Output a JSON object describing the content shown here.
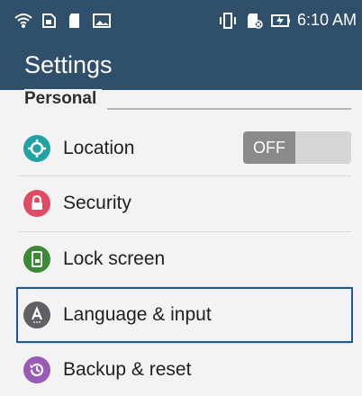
{
  "status_bar": {
    "time": "6:10 AM",
    "icons_left": [
      "wifi-icon",
      "sim-icon",
      "sd-card-icon",
      "image-icon"
    ],
    "icons_right": [
      "vibrate-icon",
      "sd-card-off-icon",
      "battery-charging-icon"
    ]
  },
  "app_bar": {
    "title": "Settings"
  },
  "section": {
    "label": "Personal"
  },
  "items": [
    {
      "label": "Location",
      "icon": "location-icon",
      "color": "#1fa3a3",
      "toggle": "OFF"
    },
    {
      "label": "Security",
      "icon": "lock-icon",
      "color": "#e04a62"
    },
    {
      "label": "Lock screen",
      "icon": "lock-screen-icon",
      "color": "#3b8a35"
    },
    {
      "label": "Language & input",
      "icon": "language-icon",
      "color": "#5f6063"
    },
    {
      "label": "Backup & reset",
      "icon": "backup-icon",
      "color": "#9a5bb7"
    }
  ],
  "colors": {
    "bar": "#2f4f6b",
    "focus": "#1e5a96"
  }
}
